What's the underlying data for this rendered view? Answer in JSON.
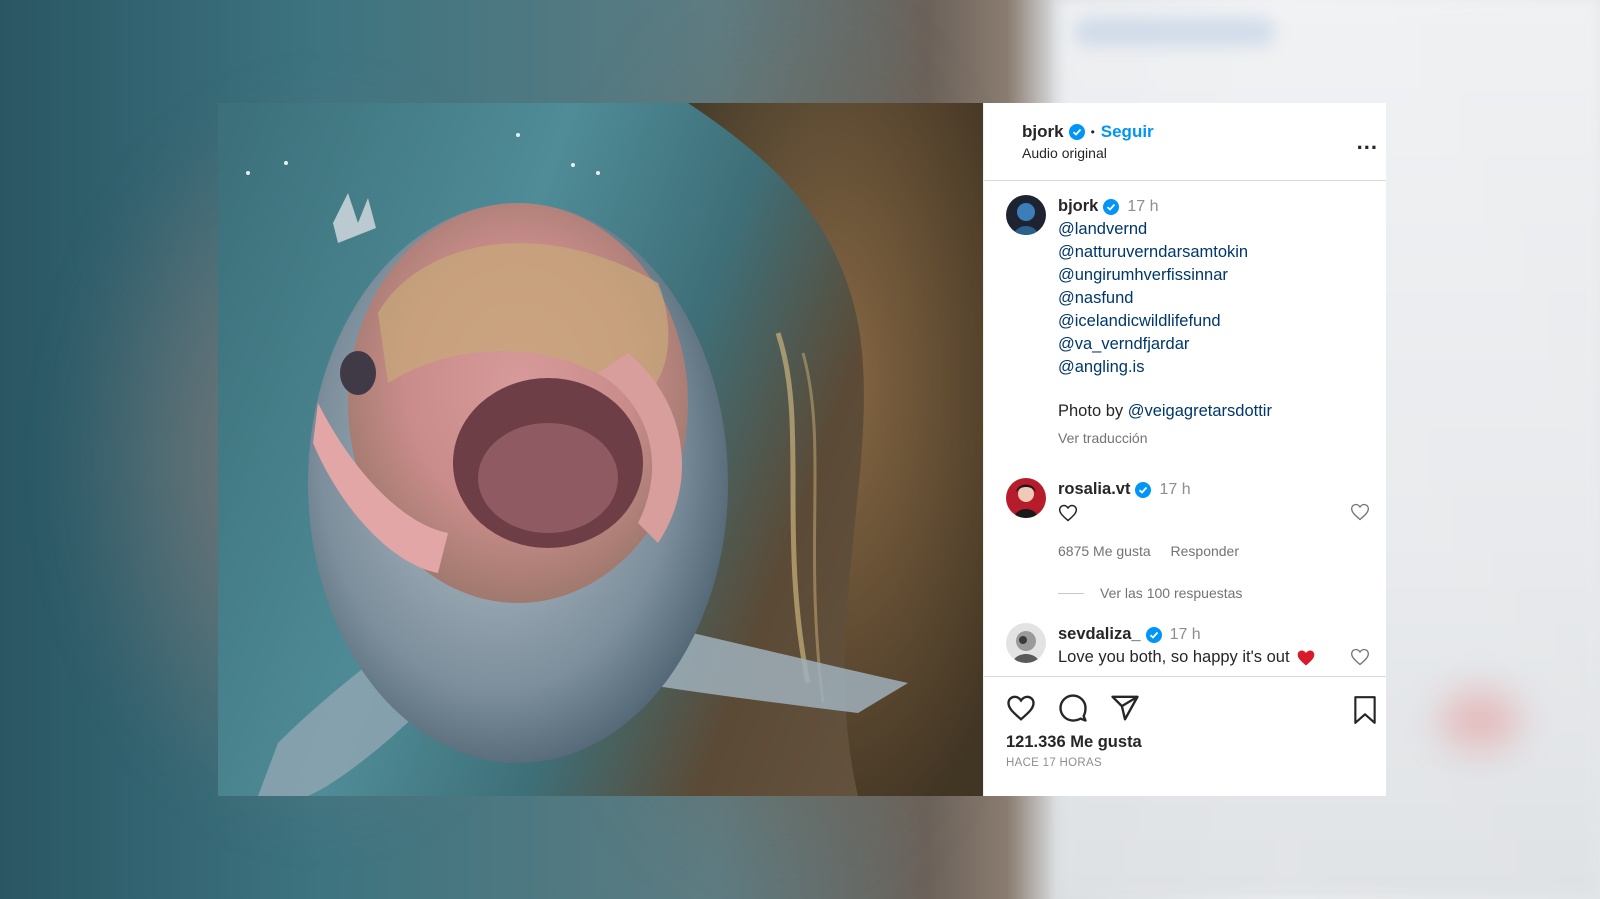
{
  "post": {
    "username": "bjork",
    "follow_label": "Seguir",
    "dot": "•",
    "audio": "Audio original",
    "more_label": "...",
    "caption": {
      "username": "bjork",
      "time": "17 h",
      "mentions": [
        "@landvernd",
        "@natturuverndarsamtokin",
        "@ungirumhverfissinnar",
        "@nasfund",
        "@icelandicwildlifefund",
        "@va_verndfjardar",
        "@angling.is"
      ],
      "photo_by_prefix": "Photo by ",
      "photo_by_mention": "@veigagretarsdottir",
      "translate": "Ver traducción"
    },
    "comments": [
      {
        "username": "rosalia.vt",
        "time": "17 h",
        "text_icon": "heart-outline-icon",
        "likes": "6875 Me gusta",
        "reply": "Responder",
        "replies": "Ver las 100 respuestas"
      },
      {
        "username": "sevdaliza_",
        "time": "17 h",
        "text": "Love you both, so happy it's out",
        "emoji": "red-heart-icon"
      }
    ],
    "likes": "121.336 Me gusta",
    "ago": "HACE 17 HORAS"
  },
  "colors": {
    "accent": "#0095f6",
    "verified": "#0095f6",
    "heart": "#ed4956"
  }
}
